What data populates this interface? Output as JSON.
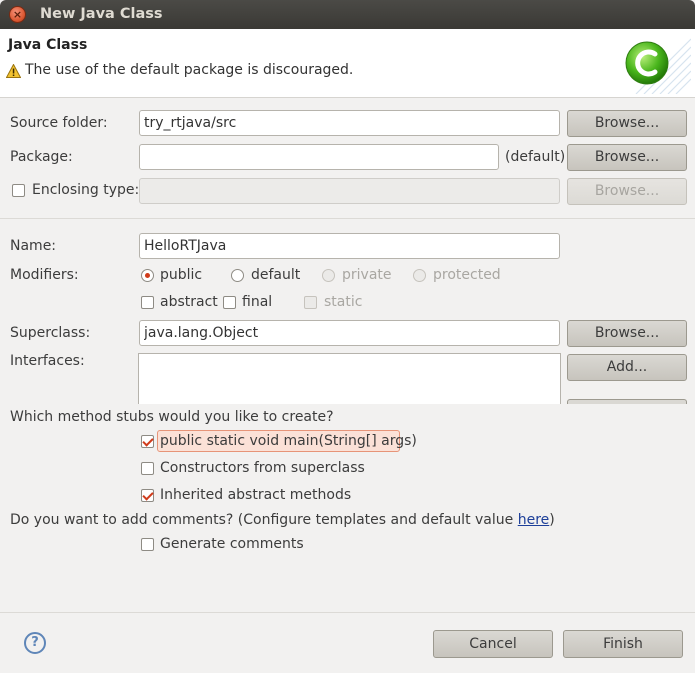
{
  "window": {
    "title": "New Java Class",
    "close_icon": "close-icon"
  },
  "header": {
    "title": "Java Class",
    "message": "The use of the default package is discouraged.",
    "warning_icon": "warning-icon",
    "logo": "java-class-logo-icon"
  },
  "form": {
    "source_folder": {
      "label": "Source folder:",
      "value": "try_rtjava/src",
      "browse": "Browse..."
    },
    "package": {
      "label": "Package:",
      "value": "",
      "suffix": "(default)",
      "browse": "Browse..."
    },
    "enclosing_type": {
      "label": "Enclosing type:",
      "value": "",
      "browse": "Browse..."
    },
    "name": {
      "label": "Name:",
      "value": "HelloRTJava"
    },
    "modifiers": {
      "label": "Modifiers:",
      "public": "public",
      "default": "default",
      "private": "private",
      "protected": "protected",
      "abstract": "abstract",
      "final": "final",
      "static": "static"
    },
    "superclass": {
      "label": "Superclass:",
      "value": "java.lang.Object",
      "browse": "Browse..."
    },
    "interfaces": {
      "label": "Interfaces:",
      "add": "Add..."
    }
  },
  "stubs": {
    "question": "Which method stubs would you like to create?",
    "main": "public static void main(String[] args)",
    "constructors": "Constructors from superclass",
    "inherited": "Inherited abstract methods"
  },
  "comments": {
    "question_prefix": "Do you want to add comments? (Configure templates and default value ",
    "link": "here",
    "question_suffix": ")",
    "generate": "Generate comments"
  },
  "footer": {
    "help": "?",
    "cancel": "Cancel",
    "finish": "Finish"
  },
  "colors": {
    "accent": "#d03b1b",
    "titlebar": "#3c3b37",
    "link": "#1d3f99"
  }
}
